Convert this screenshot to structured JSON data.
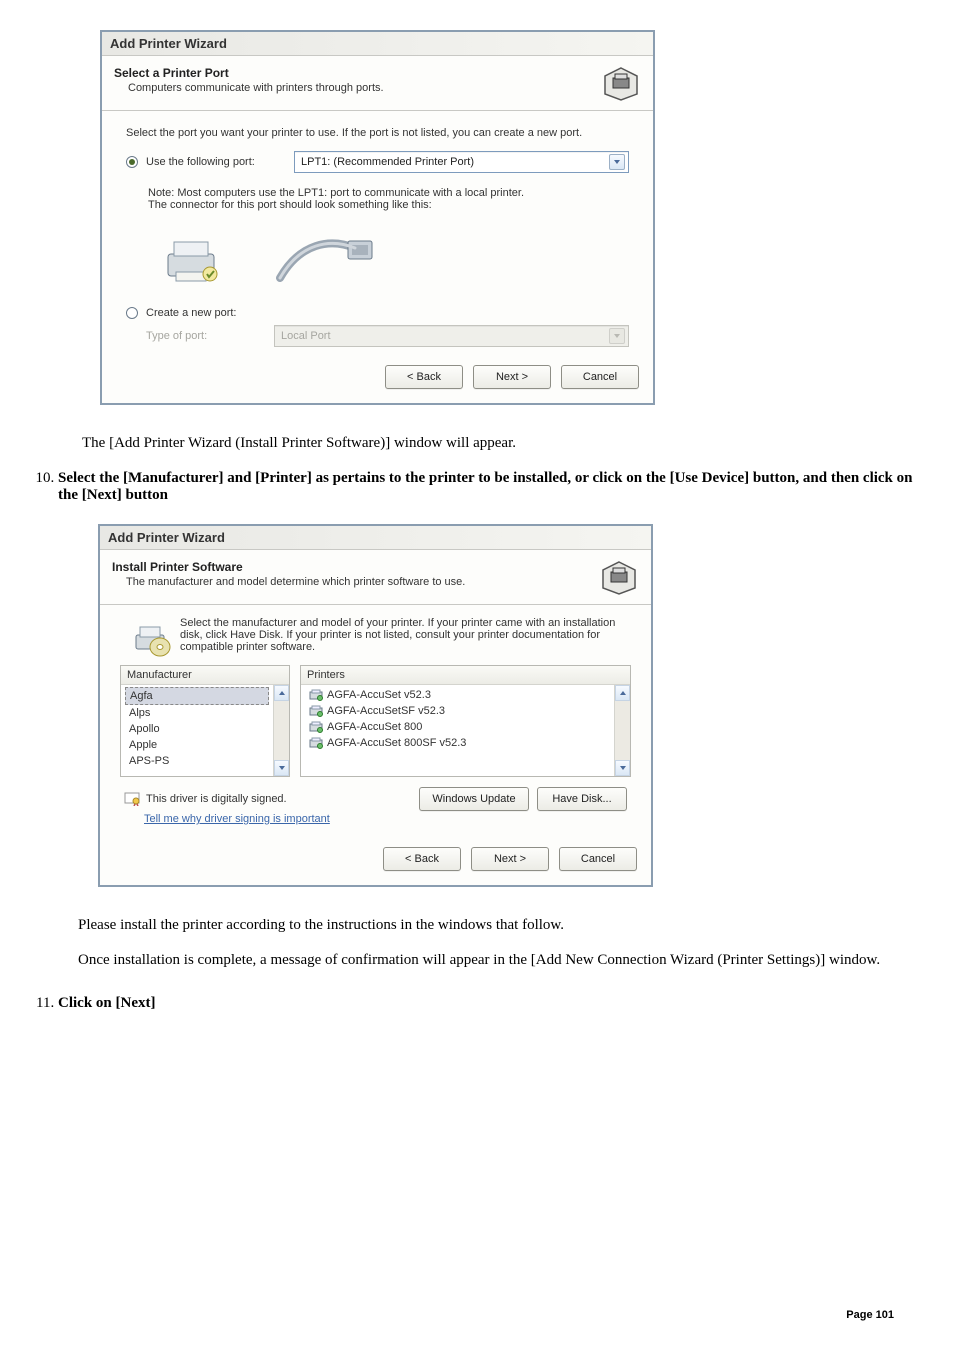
{
  "dlg1": {
    "window_title": "Add Printer Wizard",
    "head_title": "Select a Printer Port",
    "head_sub": "Computers communicate with printers through ports.",
    "instr": "Select the port you want your printer to use.  If the port is not listed, you can create a new port.",
    "opt_use_label": "Use the following port:",
    "use_port_value": "LPT1: (Recommended Printer Port)",
    "note_line1": "Note: Most computers use the LPT1: port to communicate with a local printer.",
    "note_line2": "The connector for this port should look something like this:",
    "opt_create_label": "Create a new port:",
    "type_of_port_label": "Type of port:",
    "type_of_port_value": "Local Port",
    "btn_back": "< Back",
    "btn_next": "Next >",
    "btn_cancel": "Cancel"
  },
  "doc": {
    "after1": "The [Add Printer Wizard (Install Printer Software)] window will appear.",
    "step10": "Select the [Manufacturer] and [Printer] as pertains to the printer to be installed, or click on the [Use Device] button, and then click on the [Next] button",
    "after2a": "Please install the printer according to the instructions in the windows that follow.",
    "after2b": "Once installation is complete, a message of confirmation will appear in the [Add New Connection Wizard (Printer Settings)] window.",
    "step11": "Click on [Next]",
    "page": "Page 101"
  },
  "dlg2": {
    "window_title": "Add Printer Wizard",
    "head_title": "Install Printer Software",
    "head_sub": "The manufacturer and model determine which printer software to use.",
    "instr": "Select the manufacturer and model of your printer. If your printer came with an installation disk, click Have Disk. If your printer is not listed, consult your printer documentation for compatible printer software.",
    "manu_header": "Manufacturer",
    "printers_header": "Printers",
    "manufacturers": [
      "Agfa",
      "Alps",
      "Apollo",
      "Apple",
      "APS-PS"
    ],
    "printers": [
      "AGFA-AccuSet v52.3",
      "AGFA-AccuSetSF v52.3",
      "AGFA-AccuSet 800",
      "AGFA-AccuSet 800SF v52.3"
    ],
    "signed": "This driver is digitally signed.",
    "tell_me": "Tell me why driver signing is important",
    "btn_wu": "Windows Update",
    "btn_hd": "Have Disk...",
    "btn_back": "< Back",
    "btn_next": "Next >",
    "btn_cancel": "Cancel"
  }
}
